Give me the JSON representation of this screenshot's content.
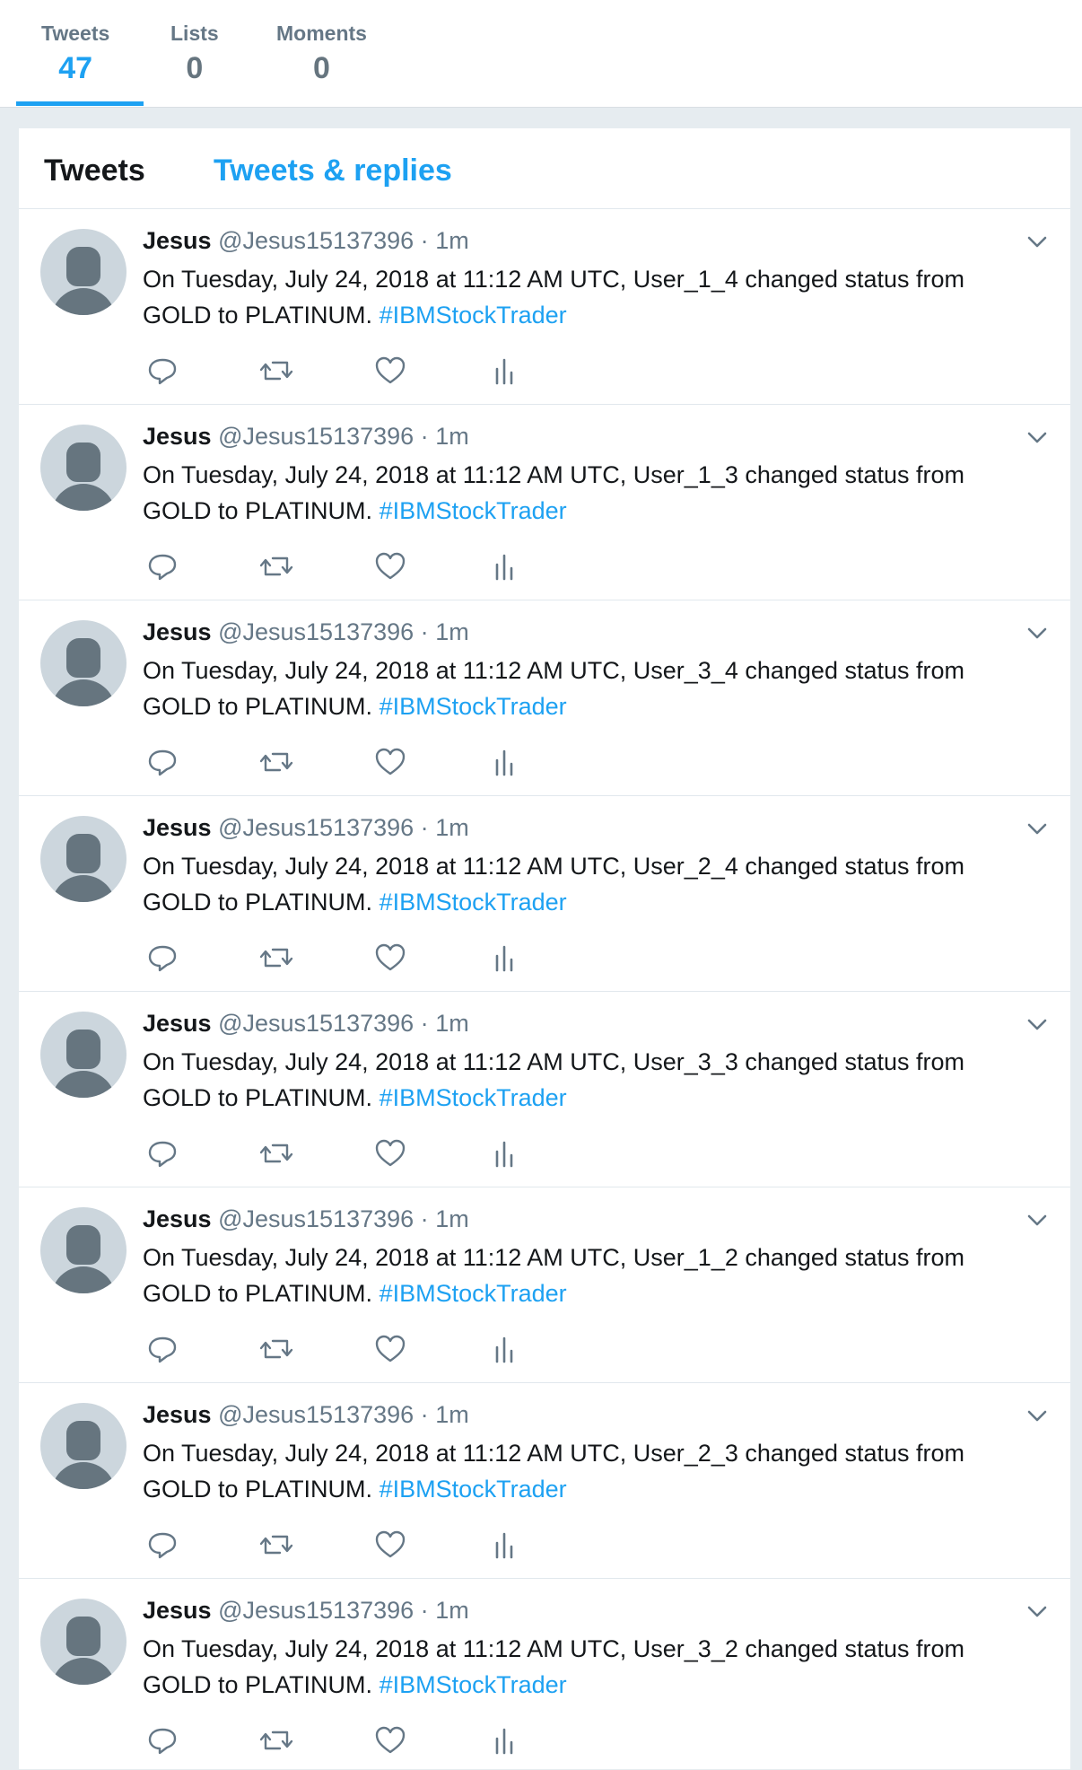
{
  "profile_nav": {
    "stats": [
      {
        "label": "Tweets",
        "value": "47"
      },
      {
        "label": "Lists",
        "value": "0"
      },
      {
        "label": "Moments",
        "value": "0"
      }
    ]
  },
  "timeline": {
    "tabs": [
      {
        "label": "Tweets"
      },
      {
        "label": "Tweets & replies"
      }
    ],
    "tweets": [
      {
        "fullname": "Jesus",
        "username": "@Jesus15137396",
        "separator": "·",
        "time": "1m",
        "text": "On Tuesday, July 24, 2018 at 11:12 AM UTC, User_1_4 changed status from GOLD to PLATINUM.",
        "hashtag": "#IBMStockTrader"
      },
      {
        "fullname": "Jesus",
        "username": "@Jesus15137396",
        "separator": "·",
        "time": "1m",
        "text": "On Tuesday, July 24, 2018 at 11:12 AM UTC, User_1_3 changed status from GOLD to PLATINUM.",
        "hashtag": "#IBMStockTrader"
      },
      {
        "fullname": "Jesus",
        "username": "@Jesus15137396",
        "separator": "·",
        "time": "1m",
        "text": "On Tuesday, July 24, 2018 at 11:12 AM UTC, User_3_4 changed status from GOLD to PLATINUM.",
        "hashtag": "#IBMStockTrader"
      },
      {
        "fullname": "Jesus",
        "username": "@Jesus15137396",
        "separator": "·",
        "time": "1m",
        "text": "On Tuesday, July 24, 2018 at 11:12 AM UTC, User_2_4 changed status from GOLD to PLATINUM.",
        "hashtag": "#IBMStockTrader"
      },
      {
        "fullname": "Jesus",
        "username": "@Jesus15137396",
        "separator": "·",
        "time": "1m",
        "text": "On Tuesday, July 24, 2018 at 11:12 AM UTC, User_3_3 changed status from GOLD to PLATINUM.",
        "hashtag": "#IBMStockTrader"
      },
      {
        "fullname": "Jesus",
        "username": "@Jesus15137396",
        "separator": "·",
        "time": "1m",
        "text": "On Tuesday, July 24, 2018 at 11:12 AM UTC, User_1_2 changed status from GOLD to PLATINUM.",
        "hashtag": "#IBMStockTrader"
      },
      {
        "fullname": "Jesus",
        "username": "@Jesus15137396",
        "separator": "·",
        "time": "1m",
        "text": "On Tuesday, July 24, 2018 at 11:12 AM UTC, User_2_3 changed status from GOLD to PLATINUM.",
        "hashtag": "#IBMStockTrader"
      },
      {
        "fullname": "Jesus",
        "username": "@Jesus15137396",
        "separator": "·",
        "time": "1m",
        "text": "On Tuesday, July 24, 2018 at 11:12 AM UTC, User_3_2 changed status from GOLD to PLATINUM.",
        "hashtag": "#IBMStockTrader"
      }
    ]
  },
  "icons": {
    "reply": "reply-icon",
    "retweet": "retweet-icon",
    "like": "heart-icon",
    "analytics": "analytics-icon",
    "caret": "chevron-down-icon",
    "avatar": "default-avatar-icon"
  },
  "colors": {
    "accent": "#1da1f2",
    "muted": "#657786",
    "background": "#e6ecf0"
  }
}
